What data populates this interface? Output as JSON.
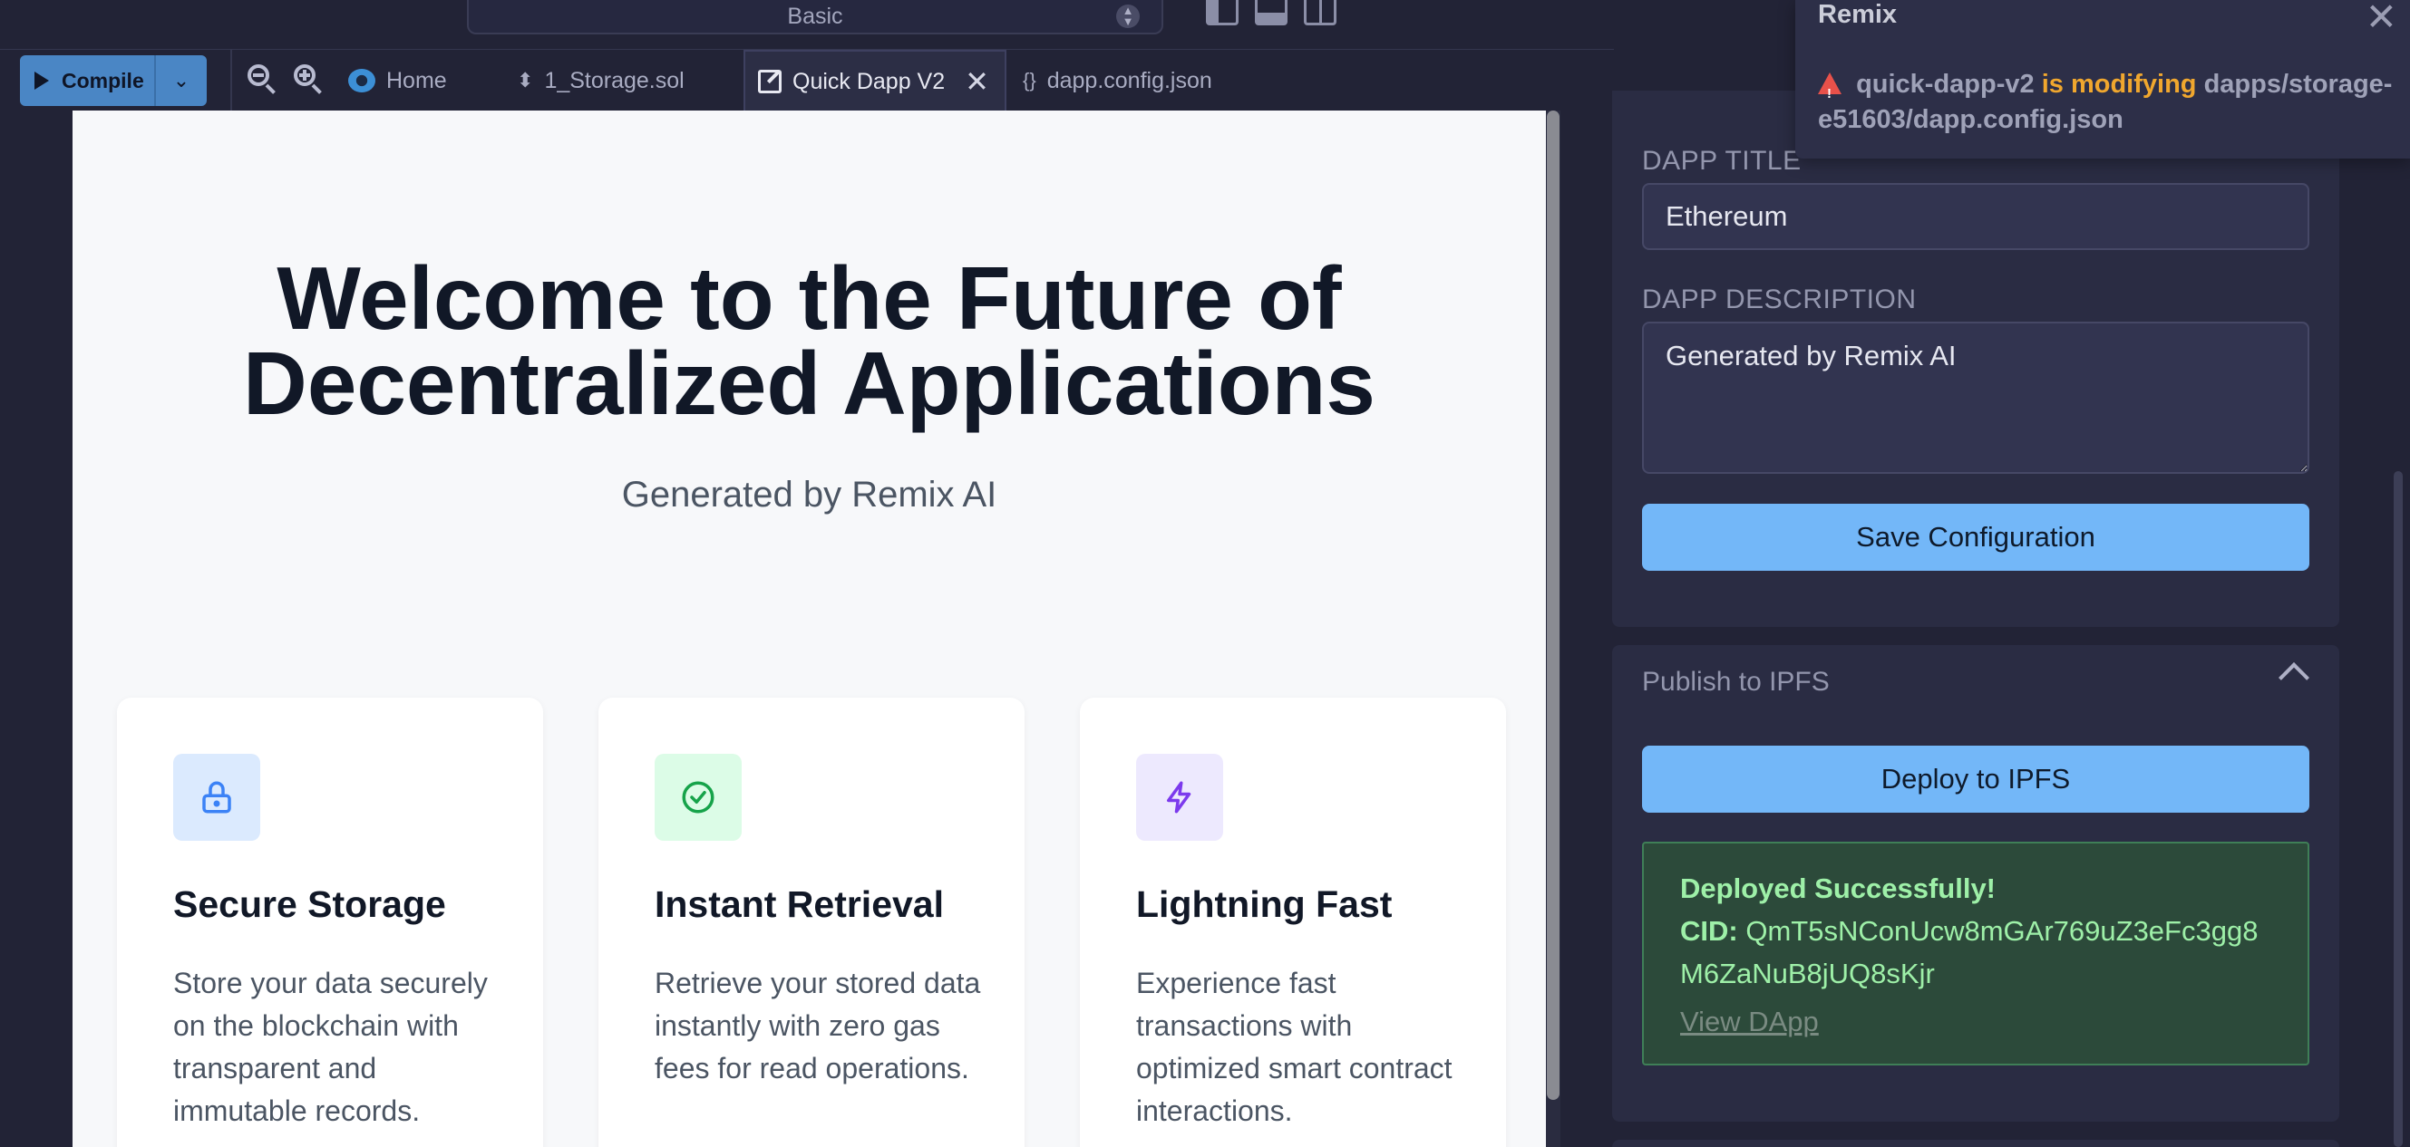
{
  "toolbar": {
    "mode_select": "Basic",
    "compile_label": "Compile"
  },
  "tabs": [
    {
      "label": "Home"
    },
    {
      "label": "1_Storage.sol"
    },
    {
      "label": "Quick Dapp V2"
    },
    {
      "label": "dapp.config.json"
    }
  ],
  "preview": {
    "hero_title": "Welcome to the Future of Decentralized Applications",
    "hero_subtitle": "Generated by Remix AI",
    "cards": [
      {
        "title": "Secure Storage",
        "text": "Store your data securely on the blockchain with transparent and immutable records.",
        "icon": "lock-icon",
        "color": "#3b82f6",
        "bg": "#dbeafe"
      },
      {
        "title": "Instant Retrieval",
        "text": "Retrieve your stored data instantly with zero gas fees for read operations.",
        "icon": "check-circle-icon",
        "color": "#16a34a",
        "bg": "#dcfce7"
      },
      {
        "title": "Lightning Fast",
        "text": "Experience fast transactions with optimized smart contract interactions.",
        "icon": "lightning-icon",
        "color": "#7c3aed",
        "bg": "#ede9fe"
      }
    ]
  },
  "config": {
    "title_label": "DAPP TITLE",
    "title_value": "Ethereum",
    "description_label": "DAPP DESCRIPTION",
    "description_value": "Generated by Remix AI",
    "save_label": "Save Configuration"
  },
  "ipfs": {
    "section_title": "Publish to IPFS",
    "deploy_label": "Deploy to IPFS",
    "success_text": "Deployed Successfully!",
    "cid_label": "CID:",
    "cid_value": "QmT5sNConUcw8mGAr769uZ3eFc3gg8M6ZaNuB8jUQ8sKjr",
    "view_label": "View DApp"
  },
  "toast": {
    "title": "Remix",
    "plugin": "quick-dapp-v2",
    "action": "is modifying",
    "path": "dapps/storage-e51603/dapp.config.json"
  },
  "colors": {
    "accent": "#73b7f8",
    "compile": "#4a86c5",
    "success_bg": "#2c4a3a",
    "success_text": "#9ef0a8",
    "warning": "#f0a72e"
  }
}
